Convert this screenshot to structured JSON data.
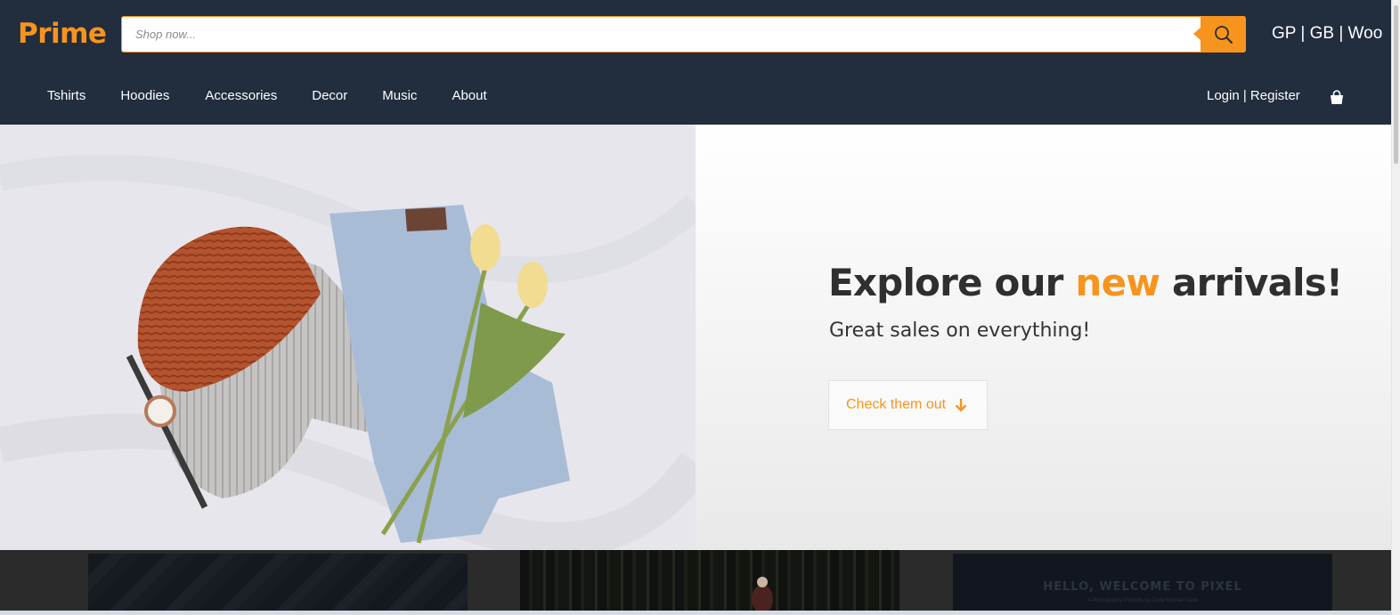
{
  "header": {
    "logo": "Prime",
    "search": {
      "placeholder": "Shop now..."
    },
    "top_links": "GP | GB | Woo"
  },
  "nav": {
    "items": [
      "Tshirts",
      "Hoodies",
      "Accessories",
      "Decor",
      "Music",
      "About"
    ],
    "account": "Login | Register"
  },
  "hero": {
    "headline_part1": "Explore our ",
    "headline_accent": "new",
    "headline_part2": " arrivals!",
    "subheadline": "Great sales on everything!",
    "cta_label": "Check them out"
  },
  "cards": {
    "card3_title": "HELLO, WELCOME TO PIXEL",
    "card3_subtitle": "A Photography Portfolio by Code Michael Vane"
  },
  "colors": {
    "header_bg": "#222d3d",
    "accent": "#f7941d",
    "headline_text": "#2f2f2f"
  },
  "icons": [
    "search-icon",
    "shopping-bag-icon",
    "arrow-down-icon"
  ]
}
